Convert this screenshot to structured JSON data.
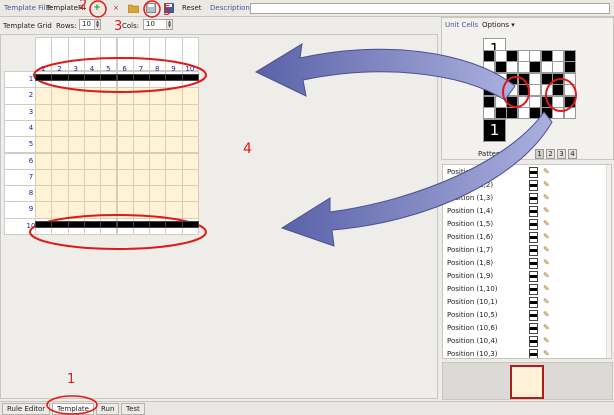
{
  "toolbar": {
    "template_file_label": "Template File:",
    "template_file_value": "TemplateFil",
    "reset_label": "Reset",
    "description_label": "Description:"
  },
  "template_grid": {
    "label": "Template Grid",
    "rows_label": "Rows:",
    "rows_value": "10",
    "cols_label": "Cols:",
    "cols_value": "10",
    "col_numbers": [
      "1",
      "2",
      "3",
      "4",
      "5",
      "6",
      "7",
      "8",
      "9",
      "10"
    ],
    "row_numbers": [
      "1",
      "2",
      "3",
      "4",
      "5",
      "6",
      "7",
      "8",
      "9",
      "10"
    ],
    "black_rows": [
      1,
      10
    ]
  },
  "unit_cells": {
    "tab_label": "Unit Cells",
    "options_label": "Options",
    "label_top": "1",
    "label_bottom": "1",
    "pattern_level_label": "Pattern Level:",
    "levels": [
      "1",
      "2",
      "3",
      "4"
    ],
    "active_level": "1"
  },
  "positions": [
    "Position (1,1)",
    "Position (1,2)",
    "Position (1,3)",
    "Position (1,4)",
    "Position (1,5)",
    "Position (1,6)",
    "Position (1,7)",
    "Position (1,8)",
    "Position (1,9)",
    "Position (1,10)",
    "Position (10,1)",
    "Position (10,5)",
    "Position (10,6)",
    "Position (10,4)",
    "Position (10,3)"
  ],
  "bottom_tabs": [
    "Rule Editor",
    "Template",
    "Run",
    "Test"
  ],
  "active_tab": "Template",
  "annotations": {
    "n1": "1",
    "n2": "2",
    "n3": "3",
    "n4": "4",
    "n5": "5"
  },
  "colors": {
    "annotation_red": "#e01818",
    "arrow_fill": "#7d84bf",
    "cell_fill": "#fff2d6"
  }
}
